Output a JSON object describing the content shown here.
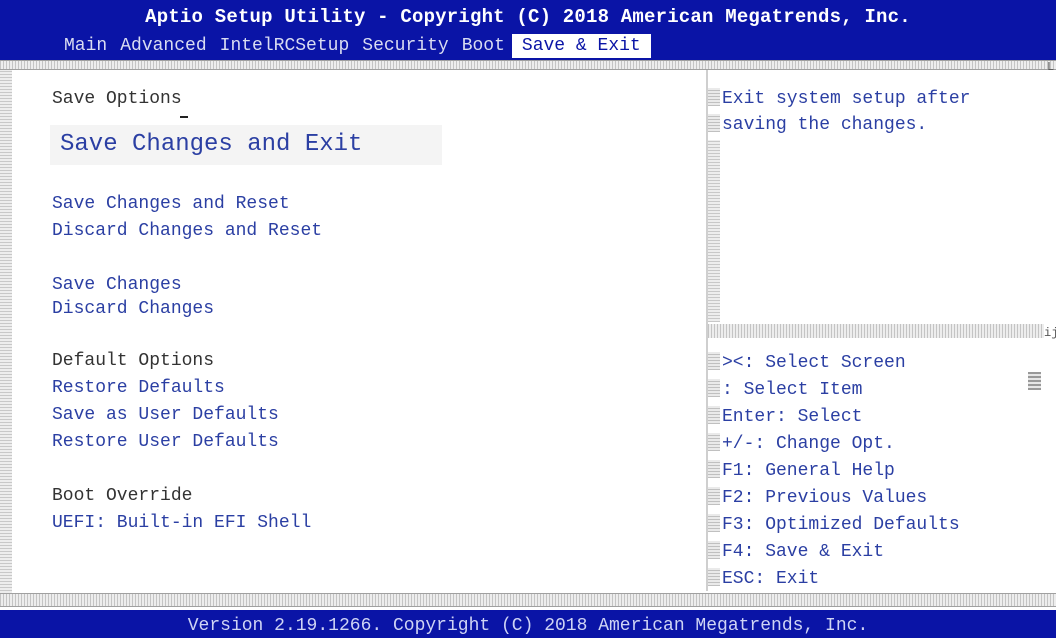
{
  "app": {
    "title": "Aptio Setup Utility - Copyright (C) 2018 American Megatrends, Inc.",
    "footer": "Version 2.19.1266. Copyright (C) 2018 American Megatrends, Inc."
  },
  "tabs": [
    {
      "label": "Main"
    },
    {
      "label": "Advanced"
    },
    {
      "label": "IntelRCSetup"
    },
    {
      "label": "Security"
    },
    {
      "label": "Boot"
    },
    {
      "label": "Save & Exit",
      "active": true
    }
  ],
  "menu": {
    "save_options_header": "Save Options",
    "save_changes_and_exit": "Save Changes and Exit",
    "save_changes_and_reset": "Save Changes and Reset",
    "discard_changes_and_reset": "Discard Changes and Reset",
    "save_changes": "Save Changes",
    "discard_changes": "Discard Changes",
    "default_options_header": "Default Options",
    "restore_defaults": "Restore Defaults",
    "save_as_user_defaults": "Save as User Defaults",
    "restore_user_defaults": "Restore User Defaults",
    "boot_override_header": "Boot Override",
    "uefi_shell": "UEFI: Built-in EFI Shell"
  },
  "help": {
    "text": "Exit system setup after saving the changes."
  },
  "keys": [
    "><: Select Screen",
    ": Select Item",
    "Enter: Select",
    "+/-: Change Opt.",
    "F1: General Help",
    "F2: Previous Values",
    "F3: Optimized Defaults",
    "F4: Save & Exit",
    "ESC: Exit"
  ],
  "colors": {
    "header_blue": "#0a14a6",
    "item_blue": "#2b3fa3"
  }
}
